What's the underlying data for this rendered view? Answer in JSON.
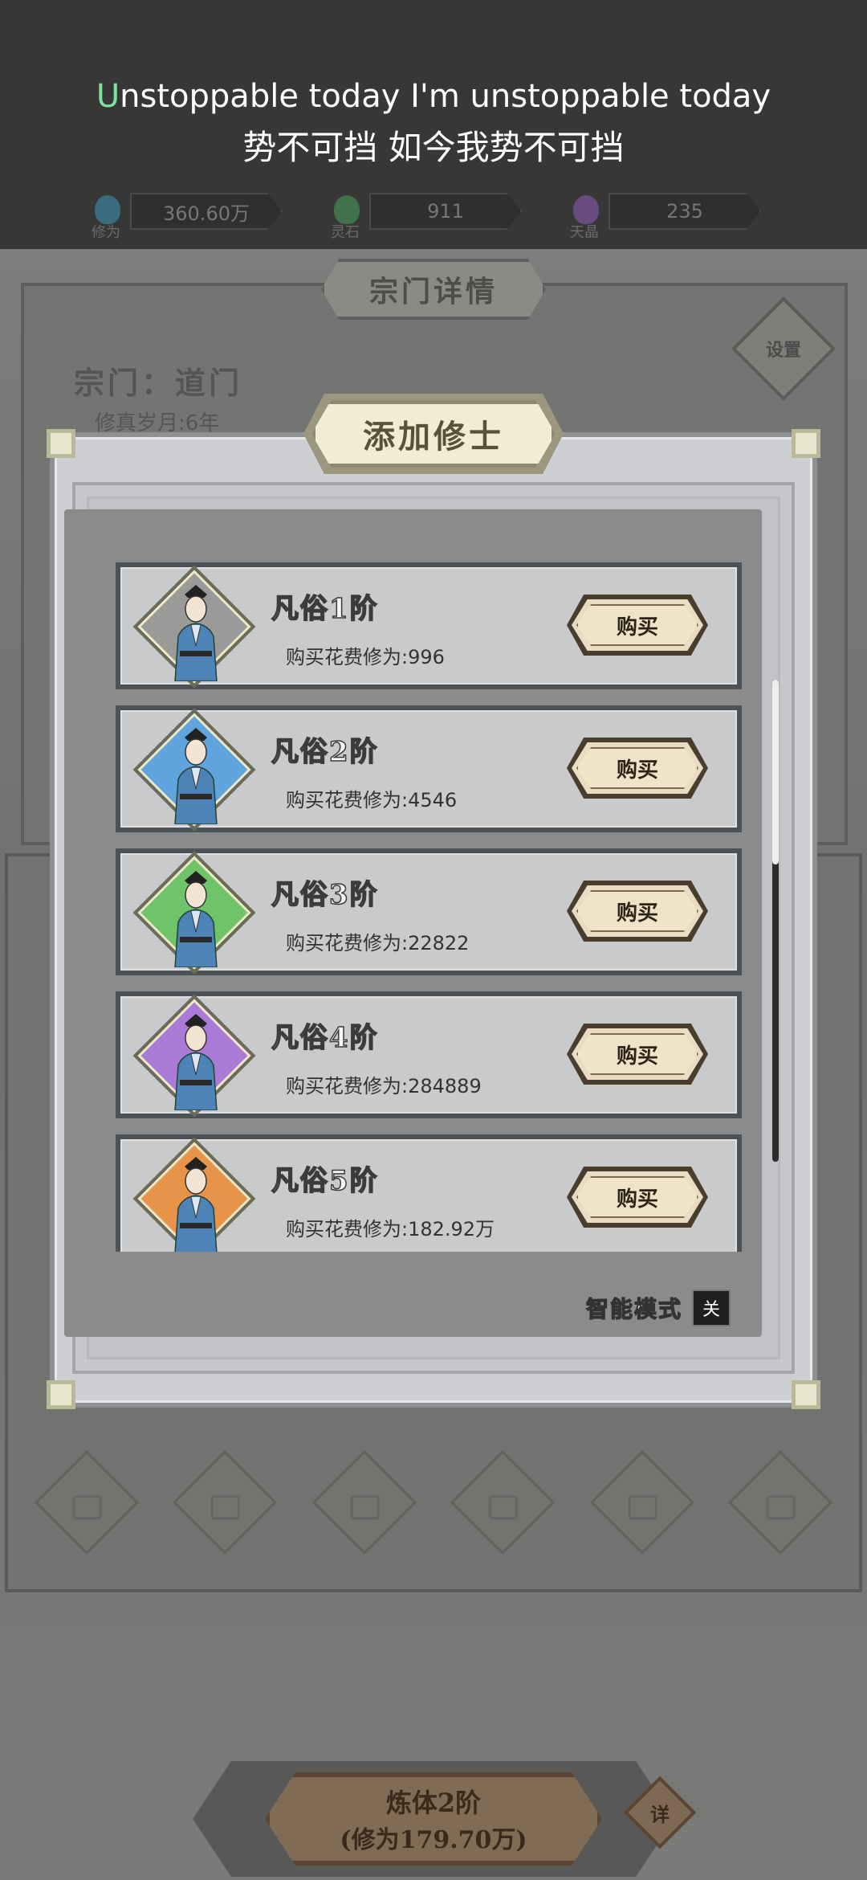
{
  "caption": {
    "english_first_letter": "U",
    "english_rest": "nstoppable today I'm unstoppable today",
    "chinese": "势不可挡 如今我势不可挡"
  },
  "resources": [
    {
      "icon": "cultivation-flame-icon",
      "label": "修为",
      "value": "360.60万",
      "color": "#3a8fb0"
    },
    {
      "icon": "spirit-stone-icon",
      "label": "灵石",
      "value": "911",
      "color": "#4a9a5a"
    },
    {
      "icon": "crystal-icon",
      "label": "天晶",
      "value": "235",
      "color": "#8a5ab0"
    }
  ],
  "background": {
    "sect_panel_title": "宗门详情",
    "sect_name": "宗门：道门",
    "sect_years": "修真岁月:6年",
    "settings_label": "设置",
    "bottom_button_line1": "炼体2阶",
    "bottom_button_line2": "(修为179.70万)",
    "detail_label": "详"
  },
  "modal": {
    "title": "添加修士",
    "buy_label": "购买",
    "cost_prefix": "购买花费修为:",
    "smart_mode_label": "智能模式",
    "smart_mode_state": "关",
    "items": [
      {
        "name": "凡俗1阶",
        "cost": "996",
        "frame_color": "#9a9a98"
      },
      {
        "name": "凡俗2阶",
        "cost": "4546",
        "frame_color": "#5fa4dc"
      },
      {
        "name": "凡俗3阶",
        "cost": "22822",
        "frame_color": "#6fc46a"
      },
      {
        "name": "凡俗4阶",
        "cost": "284889",
        "frame_color": "#a97bd6"
      },
      {
        "name": "凡俗5阶",
        "cost": "182.92万",
        "frame_color": "#e8934a"
      }
    ]
  }
}
